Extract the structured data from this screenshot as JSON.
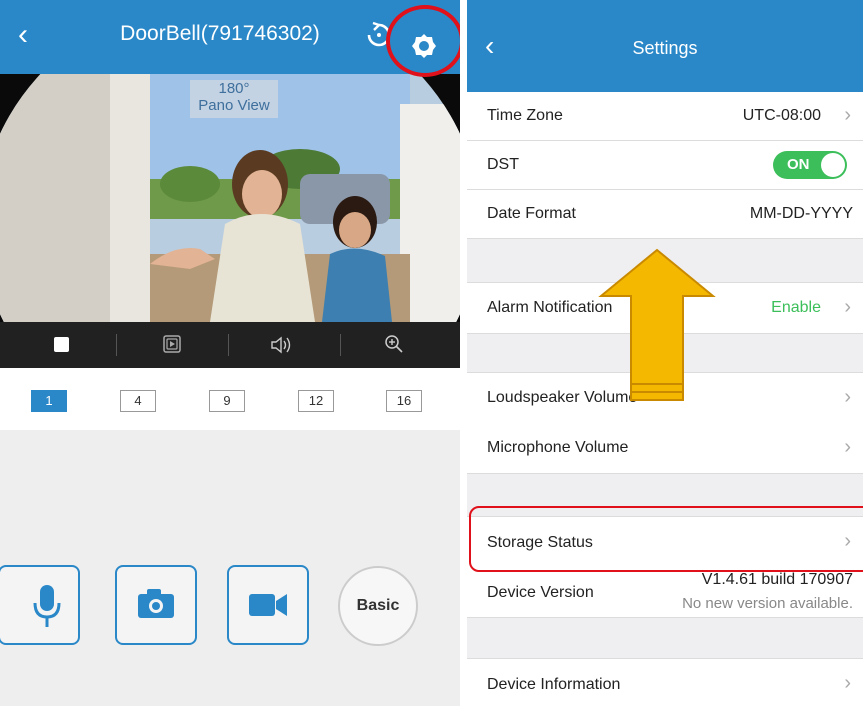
{
  "left": {
    "title": "DoorBell(791746302)",
    "video_overlay": [
      "180°",
      "Pano View"
    ],
    "split_buttons": [
      "1",
      "4",
      "9",
      "12",
      "16"
    ],
    "basic_label": "Basic"
  },
  "right": {
    "title": "Settings",
    "time_zone": {
      "label": "Time Zone",
      "value": "UTC-08:00"
    },
    "dst": {
      "label": "DST",
      "toggle": "ON"
    },
    "date_format": {
      "label": "Date Format",
      "value": "MM-DD-YYYY"
    },
    "alarm": {
      "label": "Alarm Notification",
      "value": "Enable"
    },
    "loudspeaker": {
      "label": "Loudspeaker Volume"
    },
    "microphone": {
      "label": "Microphone Volume"
    },
    "storage": {
      "label": "Storage Status"
    },
    "device_version": {
      "label": "Device Version",
      "value": "V1.4.61 build 170907",
      "sub": "No new version available."
    },
    "device_info": {
      "label": "Device Information"
    }
  },
  "colors": {
    "brand_blue": "#2a88c8",
    "enable_green": "#3cbf5a",
    "highlight_red": "#e0111a",
    "arrow_yellow": "#f5b800"
  }
}
